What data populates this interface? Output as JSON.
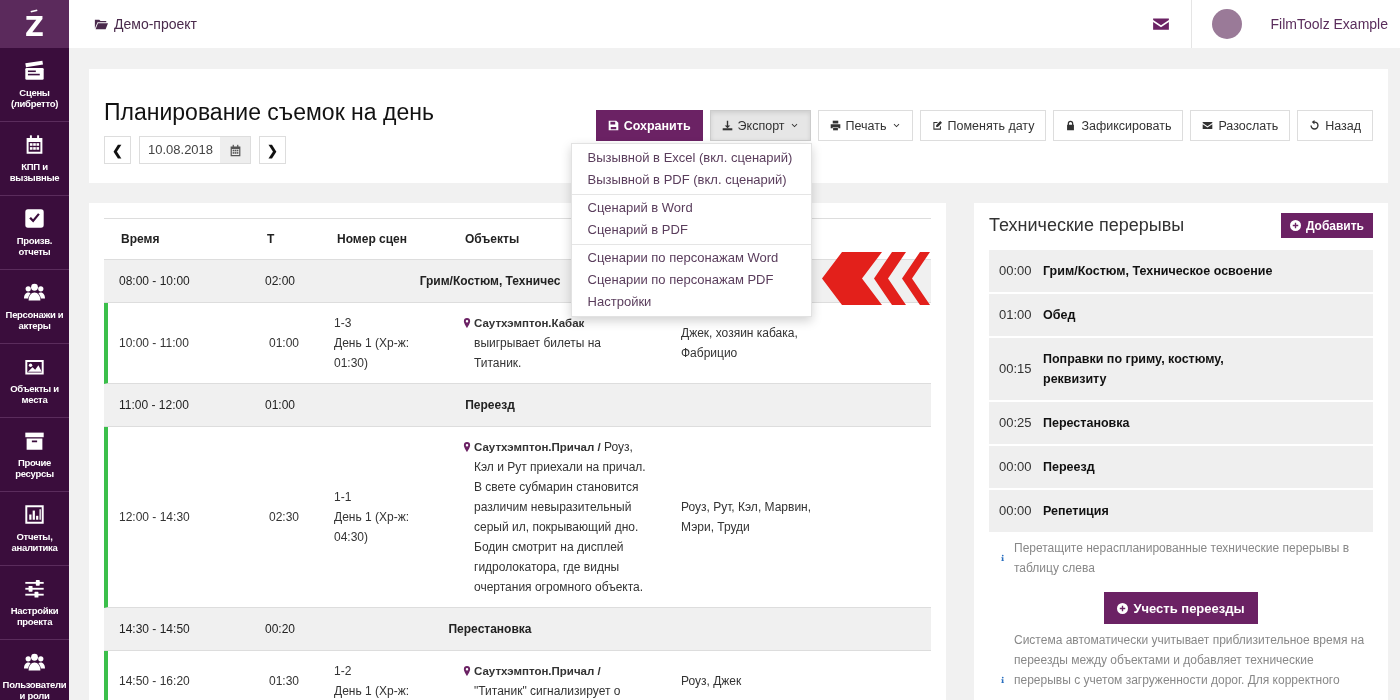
{
  "sidebar": {
    "logo": "Z",
    "items": [
      {
        "label": "Сцены (либретто)"
      },
      {
        "label": "КПП и вызывные"
      },
      {
        "label": "Произв. отчеты"
      },
      {
        "label": "Персонажи и актеры"
      },
      {
        "label": "Объекты и места"
      },
      {
        "label": "Прочие ресурсы"
      },
      {
        "label": "Отчеты, аналитика"
      },
      {
        "label": "Настройки проекта"
      },
      {
        "label": "Пользователи и роли"
      }
    ]
  },
  "topbar": {
    "project": "Демо-проект",
    "user": "FilmToolz Example"
  },
  "header": {
    "title": "Планирование съемок на день",
    "prev": "❮",
    "date": "10.08.2018",
    "next": "❯",
    "buttons": [
      {
        "label": "Сохранить",
        "kind": "primary",
        "dropdown": false,
        "expanded": false
      },
      {
        "label": "Экспорт",
        "kind": "default",
        "dropdown": true,
        "expanded": true,
        "menu": [
          [
            "Вызывной в Excel (вкл. сценарий)",
            "Вызывной в PDF (вкл. сценарий)"
          ],
          [
            "Сценарий в Word",
            "Сценарий в PDF"
          ],
          [
            "Сценарии по персонажам Word",
            "Сценарии по персонажам PDF",
            "Настройки"
          ]
        ]
      },
      {
        "label": "Печать",
        "kind": "default",
        "dropdown": true,
        "expanded": false
      },
      {
        "label": "Поменять дату",
        "kind": "default",
        "dropdown": false,
        "expanded": false
      },
      {
        "label": "Зафиксировать",
        "kind": "default",
        "dropdown": false,
        "expanded": false
      },
      {
        "label": "Разослать",
        "kind": "default",
        "dropdown": false,
        "expanded": false
      },
      {
        "label": "Назад",
        "kind": "default",
        "dropdown": false,
        "expanded": false
      }
    ]
  },
  "schedule": {
    "columns": [
      "Время",
      "Т",
      "Номер сцен",
      "Объекты"
    ],
    "rows": [
      {
        "kind": "break",
        "time": "08:00 - 10:00",
        "duration": "02:00",
        "label": "Грим/Костюм, Техничес"
      },
      {
        "kind": "scene",
        "time": "10:00 - 11:00",
        "duration": "01:00",
        "scene": "1-3",
        "day": "День 1 (Хр-ж: 01:30)",
        "objects": "**Саутхэмптон.Кабак** выигрывает билеты на Титаник.",
        "characters": "Джек, хозяин кабака, Фабрицио"
      },
      {
        "kind": "break",
        "time": "11:00 - 12:00",
        "duration": "01:00",
        "label": "Переезд"
      },
      {
        "kind": "scene",
        "time": "12:00 - 14:30",
        "duration": "02:30",
        "scene": "1-1",
        "day": "День 1 (Хр-ж: 04:30)",
        "objects": "**Саутхэмптон.Причал /** Роуз, Кэл и Рут приехали на причал. В свете субмарин становится различим невыразительный серый ил, покрывающий дно. Бодин смотрит на дисплей гидролокатора, где видны очертания огромного объекта.",
        "characters": "Роуз, Рут, Кэл, Марвин, Мэри, Труди"
      },
      {
        "kind": "break",
        "time": "14:30 - 14:50",
        "duration": "00:20",
        "label": "Перестановка"
      },
      {
        "kind": "scene",
        "time": "14:50 - 16:20",
        "duration": "01:30",
        "scene": "1-2",
        "day": "День 1 (Хр-ж:",
        "objects": "**Саутхэмптон.Причал /** \"Титаник\" сигнализирует о",
        "characters": "Роуз, Джек"
      }
    ]
  },
  "tech_breaks": {
    "title": "Технические перерывы",
    "add_button": "Добавить",
    "items": [
      {
        "time": "00:00",
        "label": "Грим/Костюм, Техническое освоение"
      },
      {
        "time": "01:00",
        "label": "Обед"
      },
      {
        "time": "00:15",
        "label": "Поправки по гриму, костюму, реквизиту"
      },
      {
        "time": "00:25",
        "label": "Перестановка"
      },
      {
        "time": "00:00",
        "label": "Переезд"
      },
      {
        "time": "00:00",
        "label": "Репетиция"
      }
    ],
    "hint": "Перетащите нераспланированные технические перерывы в таблицу слева",
    "apply_button": "Учесть переезды",
    "note": "Система автоматически учитывает приблизительное время на переезды между объектами и добавляет технические перерывы с учетом загруженности дорог. Для корректного"
  }
}
